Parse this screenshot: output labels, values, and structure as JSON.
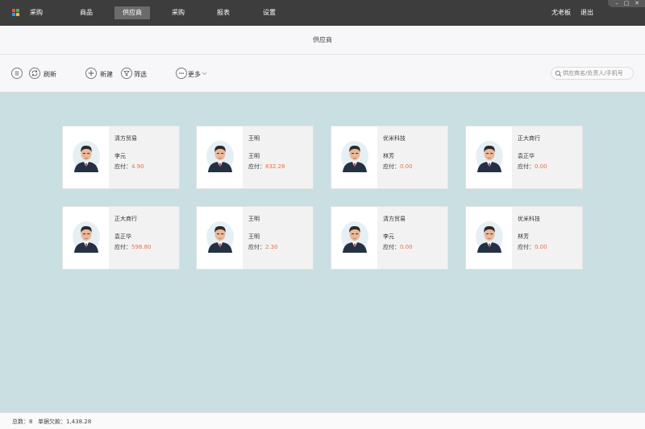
{
  "app": {
    "title": "采购"
  },
  "nav": {
    "items": [
      {
        "label": "商品"
      },
      {
        "label": "供应商"
      },
      {
        "label": "采购"
      },
      {
        "label": "报表"
      },
      {
        "label": "设置"
      }
    ],
    "active_index": 1
  },
  "user": {
    "name": "尤老板",
    "logout_label": "退出"
  },
  "window_controls": {
    "minimize": "–",
    "maximize": "□",
    "close": "✕"
  },
  "page": {
    "title": "供应商"
  },
  "toolbar": {
    "refresh_label": "刷新",
    "new_label": "新建",
    "filter_label": "筛选",
    "more_label": "更多",
    "search_placeholder": "供应商名/负责人/手机号"
  },
  "suppliers": [
    {
      "company": "清方贸易",
      "contact": "李元",
      "payable_label": "应付：",
      "payable": "4.90"
    },
    {
      "company": "王明",
      "contact": "王明",
      "payable_label": "应付：",
      "payable": "832.28"
    },
    {
      "company": "优米科技",
      "contact": "林芳",
      "payable_label": "应付：",
      "payable": "0.00"
    },
    {
      "company": "正大商行",
      "contact": "袁正华",
      "payable_label": "应付：",
      "payable": "0.00"
    },
    {
      "company": "正大商行",
      "contact": "袁正华",
      "payable_label": "应付：",
      "payable": "598.80"
    },
    {
      "company": "王明",
      "contact": "王明",
      "payable_label": "应付：",
      "payable": "2.30"
    },
    {
      "company": "清方贸易",
      "contact": "李元",
      "payable_label": "应付：",
      "payable": "0.00"
    },
    {
      "company": "优米科技",
      "contact": "林芳",
      "payable_label": "应付：",
      "payable": "0.00"
    }
  ],
  "footer": {
    "total_text": "总数：8",
    "balance_text": "单据欠款：1,438.28"
  },
  "colors": {
    "topbar": "#3d3d3d",
    "nav_active": "#6b6b6b",
    "content_bg": "#c9dfe1",
    "amount": "#e8714e"
  }
}
